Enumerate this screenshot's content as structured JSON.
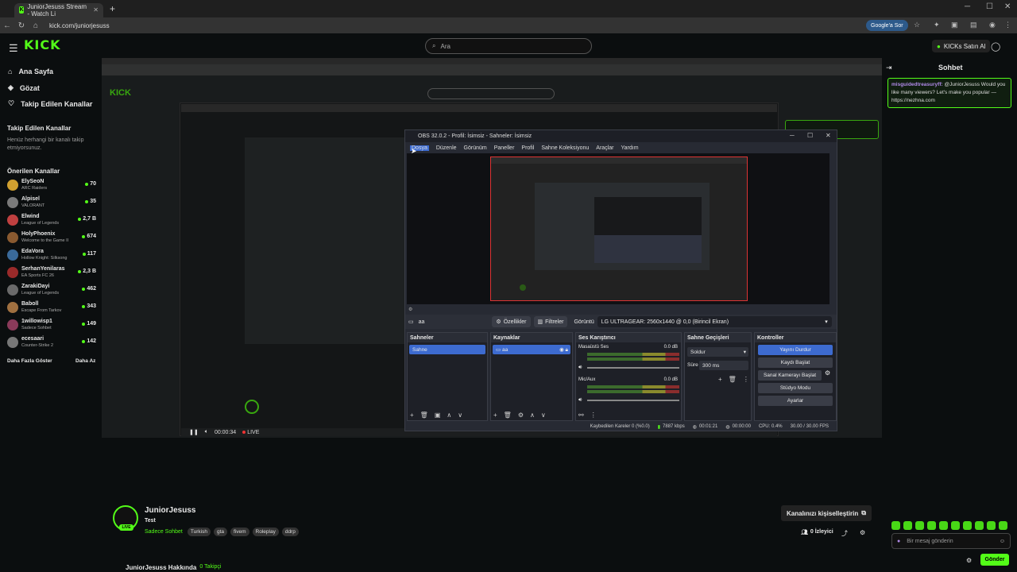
{
  "browser": {
    "tab_title": "JuniorJesuss Stream - Watch Li",
    "url": "kick.com/juniorjesuss",
    "google_button": "Google'a Sor"
  },
  "header": {
    "logo": "KICK",
    "search_placeholder": "Ara",
    "kicks_button": "KICKs Satın Al"
  },
  "sidebar": {
    "nav": [
      {
        "label": "Ana Sayfa",
        "icon": "home-icon"
      },
      {
        "label": "Gözat",
        "icon": "compass-icon"
      },
      {
        "label": "Takip Edilen Kanallar",
        "icon": "heart-icon"
      }
    ],
    "followed_title": "Takip Edilen Kanallar",
    "followed_empty": "Henüz herhangi bir kanalı takip etmiyorsunuz.",
    "recommended_title": "Önerilen Kanallar",
    "channels": [
      {
        "name": "ElySeoN",
        "game": "ARC Raiders",
        "viewers": "70"
      },
      {
        "name": "Alpisel",
        "game": "VALORANT",
        "viewers": "35"
      },
      {
        "name": "Elwind",
        "game": "League of Legends",
        "viewers": "2,7 B"
      },
      {
        "name": "HolyPhoenix",
        "game": "Welcome to the Game II",
        "viewers": "674"
      },
      {
        "name": "EdaVora",
        "game": "Hollow Knight: Silksong",
        "viewers": "117"
      },
      {
        "name": "SerhanYenilaras",
        "game": "EA Sports FC 26",
        "viewers": "2,3 B"
      },
      {
        "name": "ZarakiDayi",
        "game": "League of Legends",
        "viewers": "462"
      },
      {
        "name": "Baboll",
        "game": "Escape From Tarkov",
        "viewers": "343"
      },
      {
        "name": "1willowisp1",
        "game": "Sadece Sohbet",
        "viewers": "149"
      },
      {
        "name": "ecesaari",
        "game": "Counter-Strike 2",
        "viewers": "142"
      }
    ],
    "show_more": "Daha Fazla Göster",
    "show_less": "Daha Az"
  },
  "obs": {
    "title": "OBS 32.0.2 - Profil: İsimsiz - Sahneler: İsimsiz",
    "menu": [
      "Dosya",
      "Düzenle",
      "Görünüm",
      "Paneller",
      "Profil",
      "Sahne Koleksiyonu",
      "Araçlar",
      "Yardım"
    ],
    "source_name": "aa",
    "properties": "Özellikler",
    "filters": "Filtreler",
    "display_label": "Görüntü",
    "display_value": "LG ULTRAGEAR: 2560x1440 @ 0,0 (Birincil Ekran)",
    "docks": {
      "scenes": "Sahneler",
      "sources": "Kaynaklar",
      "mixer": "Ses Karıştırıcı",
      "transitions": "Sahne Geçişleri",
      "controls": "Kontroller"
    },
    "scene_item": "Sahne",
    "source_item": "aa",
    "mixer": [
      {
        "name": "Masaüstü Ses",
        "db": "0.0 dB"
      },
      {
        "name": "Mic/Aux",
        "db": "0.0 dB"
      }
    ],
    "transition": "Soldur",
    "duration_label": "Süre",
    "duration": "300 ms",
    "controls": [
      "Yayını Durdur",
      "Kaydı Başlat",
      "Sanal Kamerayı Başlat",
      "Stüdyo Modu",
      "Ayarlar"
    ],
    "status": {
      "dropped": "Kaybedilen Kareler 0 (%0.0)",
      "bitrate": "7887 kbps",
      "stream_time": "00:01:21",
      "rec_time": "00:00:00",
      "cpu": "CPU: 0.4%",
      "fps": "30.00 / 30.00 FPS"
    }
  },
  "player": {
    "time": "00:00:34",
    "live": "LIVE"
  },
  "stream": {
    "channel": "JuniorJesuss",
    "title": "Test",
    "category": "Sadece Sohbet",
    "tags": [
      "Turkish",
      "gta",
      "fivem",
      "Roleplay",
      "ddrp"
    ],
    "customize": "Kanalınızı kişiselleştirin",
    "viewers": "0 İzleyici",
    "about": "JuniorJesuss Hakkında",
    "followers": "0 Takipçi",
    "avatar_badge": "LIVE"
  },
  "chat": {
    "title": "Sohbet",
    "message_user": "misguidedtreasuryff:",
    "message_text": "@JuniorJesuss Would you like many viewers? Let's make you popular — https://nezhna.com",
    "input_placeholder": "Bir mesaj gönderin",
    "send": "Gönder"
  },
  "colors": {
    "brand": "#53fc18",
    "obs_accent": "#3d6bd0",
    "recording_frame": "#dd3333"
  }
}
